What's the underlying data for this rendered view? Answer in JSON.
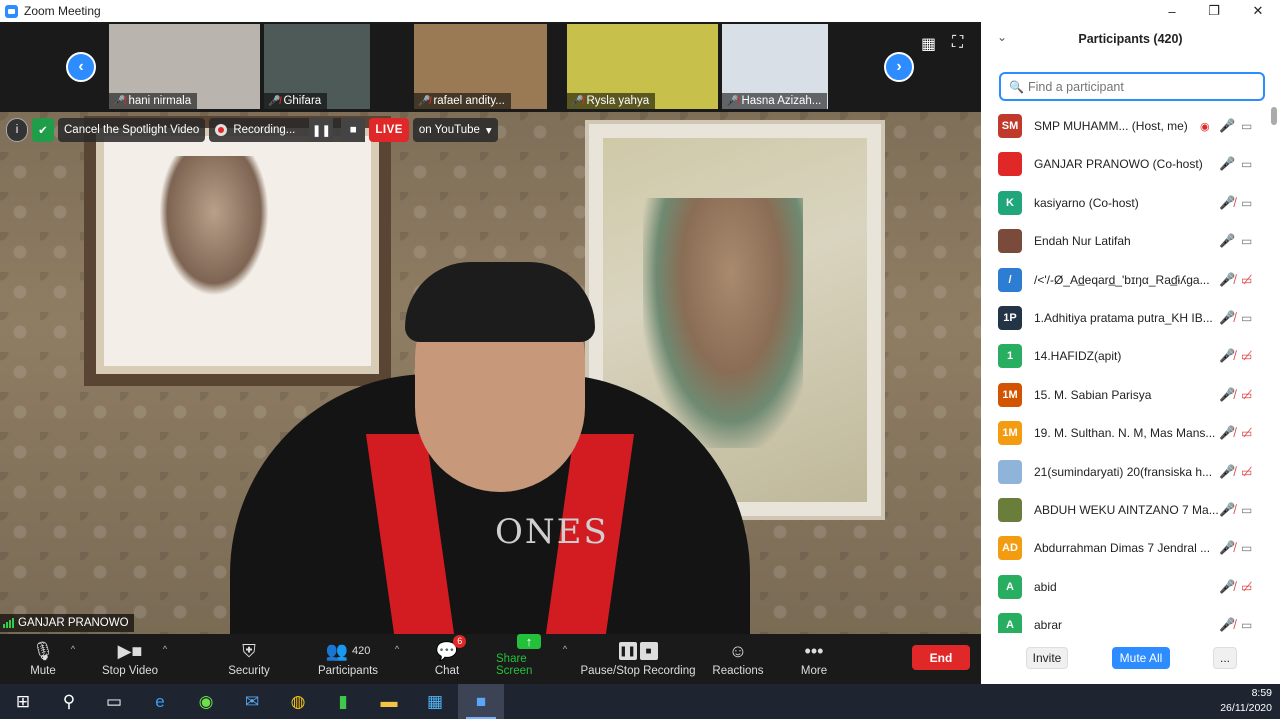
{
  "window": {
    "title": "Zoom Meeting",
    "minimize": "–",
    "restore": "❐",
    "close": "✕"
  },
  "strip": {
    "prev": "‹",
    "next": "›",
    "grid_icon": "▦",
    "fullscreen_icon": "⛶",
    "tiles": [
      {
        "name": "hani nirmala",
        "bg": "#b9b4ad"
      },
      {
        "name": "Ghifara",
        "bg": "#4e5a57"
      },
      {
        "name": "rafael andity...",
        "bg": "#9a7a55"
      },
      {
        "name": "Rysla yahya",
        "bg": "#c7c04a"
      },
      {
        "name": "Hasna Azizah...",
        "bg": "#d9dfe6"
      }
    ]
  },
  "video": {
    "info_icon": "i",
    "shield_icon": "✔",
    "spotlight": "Cancel the Spotlight Video",
    "recording": "Recording...",
    "live": "LIVE",
    "youtube": "on YouTube",
    "speaker": "GANJAR PRANOWO",
    "shirt_text": "ONES"
  },
  "toolbar": {
    "mute": "Mute",
    "stop_video": "Stop Video",
    "security": "Security",
    "participants": "Participants",
    "participants_count": "420",
    "chat": "Chat",
    "chat_badge": "6",
    "share": "Share Screen",
    "pause_recording": "Pause/Stop Recording",
    "reactions": "Reactions",
    "more": "More",
    "end": "End"
  },
  "panel": {
    "title": "Participants (420)",
    "search_placeholder": "Find a participant",
    "invite": "Invite",
    "mute_all": "Mute All",
    "more": "...",
    "participants": [
      {
        "initials": "SM",
        "color": "#c0392b",
        "name": "SMP MUHAMM...  (Host, me)",
        "muted": false,
        "video_off": false,
        "recording": true
      },
      {
        "initials": "",
        "color": "#e02828",
        "name": "GANJAR PRANOWO (Co-host)",
        "muted": false,
        "video_off": false
      },
      {
        "initials": "K",
        "color": "#1fa67a",
        "name": "kasiyarno (Co-host)",
        "muted": true,
        "video_off": false
      },
      {
        "initials": "",
        "color": "#7a4b3a",
        "name": "Endah Nur Latifah",
        "muted": false,
        "video_off": false
      },
      {
        "initials": "/",
        "color": "#2d7dd2",
        "name": "/<'/-Ø_Ad̲eqard̲_'bɪŋα_Raɗ̲ɨʎɡa...",
        "muted": true,
        "video_off": true
      },
      {
        "initials": "1P",
        "color": "#243447",
        "name": "1.Adhitiya pratama putra_KH IB...",
        "muted": true,
        "video_off": false
      },
      {
        "initials": "1",
        "color": "#27ae60",
        "name": "14.HAFIDZ(apit)",
        "muted": true,
        "video_off": true
      },
      {
        "initials": "1M",
        "color": "#d35400",
        "name": "15. M. Sabian Parisya",
        "muted": true,
        "video_off": true
      },
      {
        "initials": "1M",
        "color": "#f39c12",
        "name": "19. M. Sulthan. N. M, Mas Mans...",
        "muted": true,
        "video_off": true
      },
      {
        "initials": "",
        "color": "#8fb3d9",
        "name": "21(sumindaryati) 20(fransiska h...",
        "muted": true,
        "video_off": true
      },
      {
        "initials": "",
        "color": "#6b7d3a",
        "name": "ABDUH WEKU AINTZANO 7 Ma...",
        "muted": true,
        "video_off": false
      },
      {
        "initials": "AD",
        "color": "#f39c12",
        "name": "Abdurrahman Dimas 7 Jendral ...",
        "muted": true,
        "video_off": false
      },
      {
        "initials": "A",
        "color": "#27ae60",
        "name": "abid",
        "muted": true,
        "video_off": true
      },
      {
        "initials": "A",
        "color": "#27ae60",
        "name": "abrar",
        "muted": true,
        "video_off": false
      }
    ]
  },
  "taskbar": {
    "time": "8:59",
    "date": "26/11/2020"
  }
}
